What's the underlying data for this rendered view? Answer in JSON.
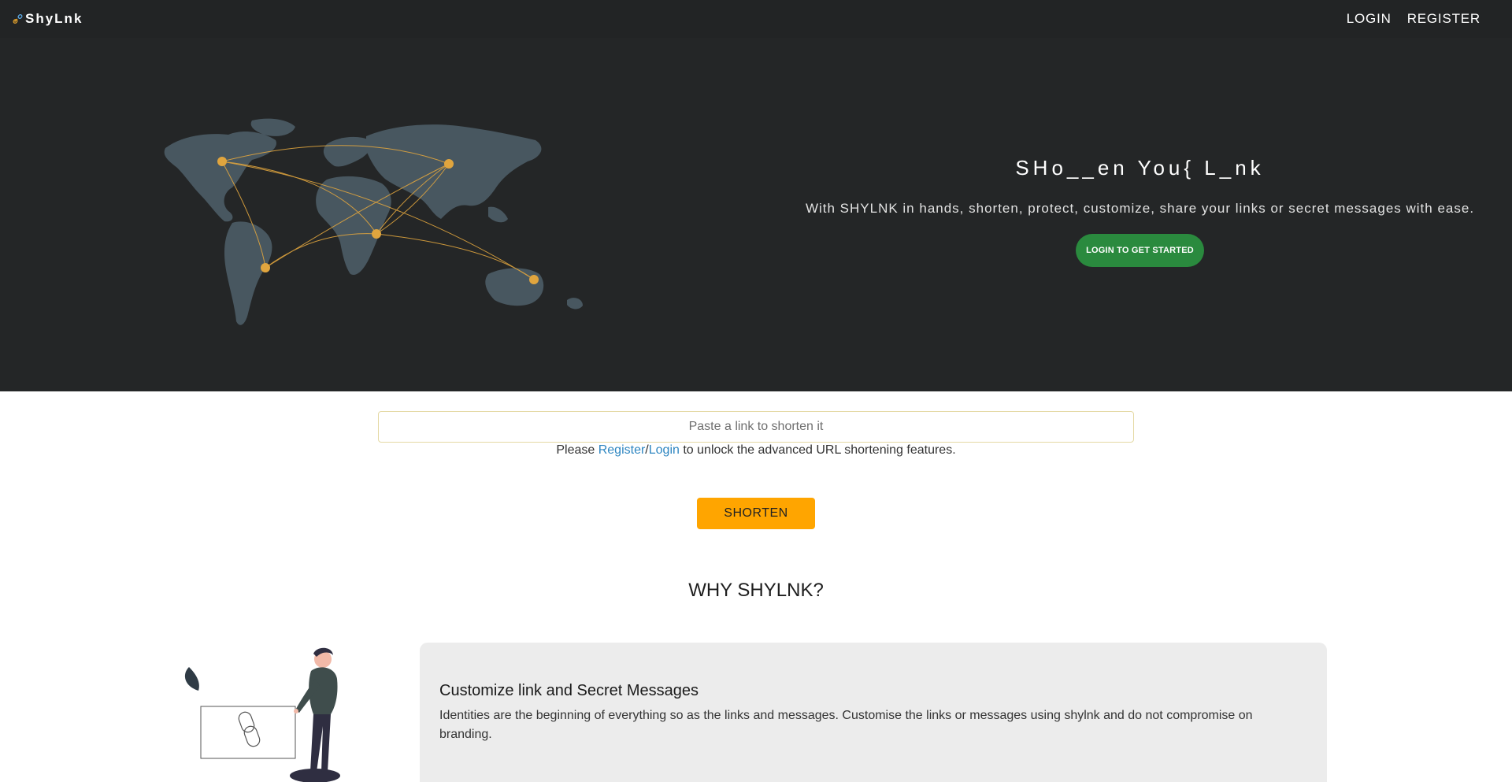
{
  "navbar": {
    "brand": "ShyLnk",
    "brand_icon": "link-icon",
    "links": [
      {
        "label": "LOGIN"
      },
      {
        "label": "REGISTER"
      }
    ]
  },
  "hero": {
    "title": "SHo__en You{ L_nk",
    "subtitle": "With SHYLNK in hands, shorten, protect, customize, share your links or secret messages with ease.",
    "cta": "LOGIN TO GET STARTED",
    "illustration_icon": "world-map-icon"
  },
  "shorten_form": {
    "placeholder": "Paste a link to shorten it",
    "note_prefix": "Please ",
    "register_link": "Register",
    "separator": "/",
    "login_link": "Login",
    "note_suffix": " to unlock the advanced URL shortening features.",
    "button": "SHORTEN"
  },
  "why": {
    "title": "WHY SHYLNK?",
    "features": [
      {
        "title": "Customize link and Secret Messages",
        "text": "Identities are the beginning of everything so as the links and messages. Customise the links or messages using shylnk and do not compromise on branding.",
        "icon": "person-with-link-illustration"
      }
    ]
  },
  "colors": {
    "navbar_bg": "#222425",
    "hero_bg": "#242627",
    "accent_orange": "#ffa500",
    "cta_green": "#2a8a3e",
    "link_blue": "#2e86c1",
    "card_bg": "#ececec"
  }
}
